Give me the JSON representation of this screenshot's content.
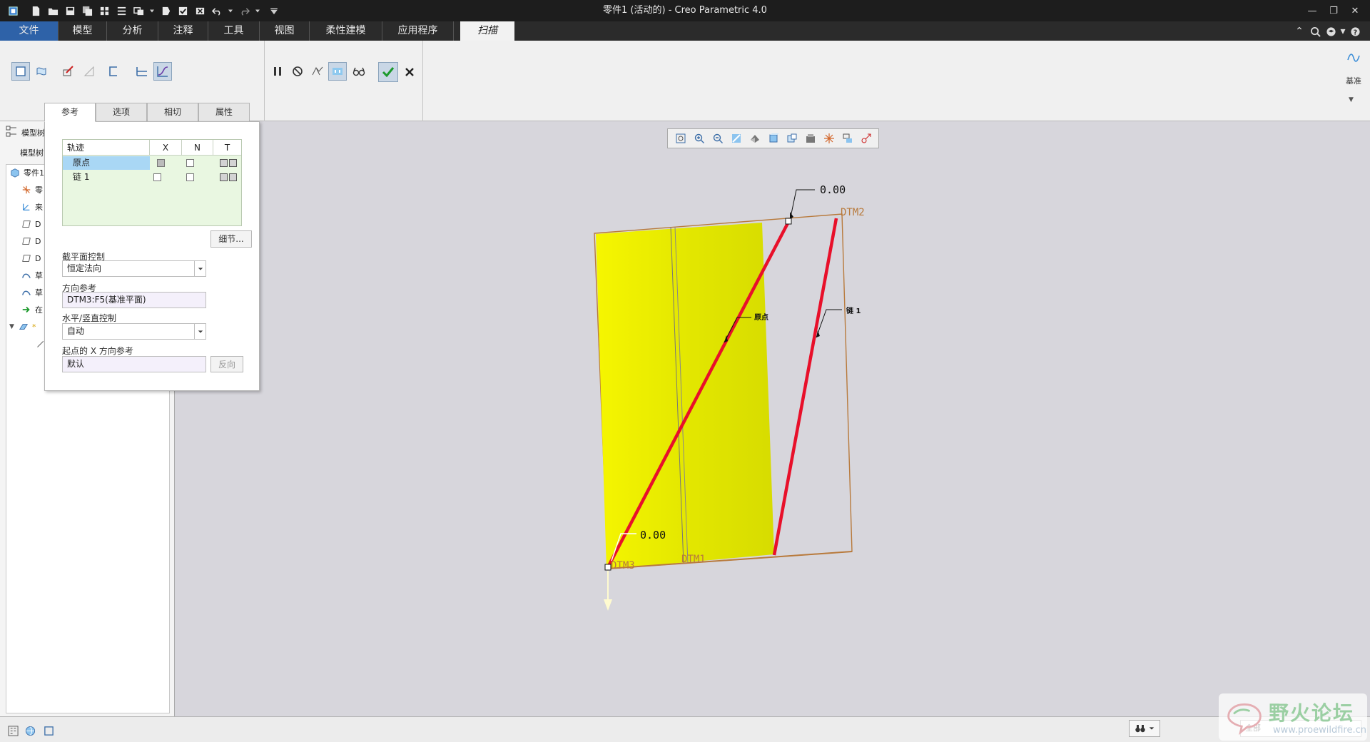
{
  "window": {
    "title": "零件1 (活动的) - Creo Parametric 4.0"
  },
  "ribbon_tabs": [
    {
      "label": "文件"
    },
    {
      "label": "模型"
    },
    {
      "label": "分析"
    },
    {
      "label": "注释"
    },
    {
      "label": "工具"
    },
    {
      "label": "视图"
    },
    {
      "label": "柔性建模"
    },
    {
      "label": "应用程序"
    },
    {
      "label": "扫描",
      "active": true
    }
  ],
  "ribbon": {
    "datum_label": "基准"
  },
  "sub_tabs": [
    {
      "label": "参考",
      "active": true
    },
    {
      "label": "选项"
    },
    {
      "label": "相切"
    },
    {
      "label": "属性"
    }
  ],
  "model_tree": {
    "header_label": "模型树",
    "header_label2": "模型树",
    "items": [
      {
        "label": "零件1",
        "icon": "part-icon"
      },
      {
        "label": "零",
        "icon": "coordinate-system-icon"
      },
      {
        "label": "来",
        "icon": "csys-icon"
      },
      {
        "label": "D",
        "icon": "datum-plane-icon"
      },
      {
        "label": "D",
        "icon": "datum-plane-icon"
      },
      {
        "label": "D",
        "icon": "datum-plane-icon"
      },
      {
        "label": "草",
        "icon": "sketch-icon"
      },
      {
        "label": "草",
        "icon": "sketch-icon"
      },
      {
        "label": "在",
        "icon": "insert-here-arrow-icon"
      },
      {
        "label": "*",
        "icon": "sweep-feature-icon"
      }
    ]
  },
  "reference_panel": {
    "table": {
      "headers": [
        "轨迹",
        "X",
        "N",
        "T"
      ],
      "rows": [
        {
          "name": "原点",
          "x": true,
          "n": false,
          "selected": true
        },
        {
          "name": "链 1",
          "x": false,
          "n": false,
          "selected": false
        }
      ]
    },
    "details_button": "细节...",
    "section_plane_label": "截平面控制",
    "section_plane_value": "恒定法向",
    "direction_ref_label": "方向参考",
    "direction_ref_value": "DTM3:F5(基准平面)",
    "hv_control_label": "水平/竖直控制",
    "hv_control_value": "自动",
    "start_x_label": "起点的 X 方向参考",
    "start_x_value": "默认",
    "flip_button": "反向"
  },
  "scene": {
    "dims": [
      "0.00",
      "0.00"
    ],
    "datum_labels": [
      "DTM2",
      "DTM3",
      "DTM1"
    ],
    "trajectory_labels": [
      "原点",
      "链 1"
    ],
    "colors": {
      "surface": "#e2e600",
      "trajectory": "#e8102a",
      "datum": "#b87a3c"
    }
  },
  "status_bar": {
    "filter_value": "全部"
  },
  "watermark": {
    "title": "野火论坛",
    "url": "www.proewildfire.cn"
  }
}
